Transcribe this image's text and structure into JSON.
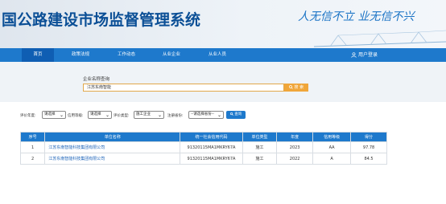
{
  "header": {
    "title": "国公路建设市场监督管理系统",
    "slogan": "人无信不立 业无信不兴"
  },
  "nav": {
    "items": [
      {
        "label": "首页"
      },
      {
        "label": "政策法规"
      },
      {
        "label": "工作动态"
      },
      {
        "label": "从业企业"
      },
      {
        "label": "从业人员"
      }
    ],
    "user_label": "用户登录"
  },
  "search": {
    "label": "企业名称查询",
    "value": "江苏东南智能",
    "button_label": "搜 索"
  },
  "filters": [
    {
      "label": "评价年度:",
      "value": "请选择"
    },
    {
      "label": "信用等级:",
      "value": "请选择"
    },
    {
      "label": "评价类型:",
      "value": "施工企业"
    },
    {
      "label": "注册省份:",
      "value": "--请选择省份--"
    }
  ],
  "query_button": "查询",
  "table": {
    "headers": [
      "序号",
      "单位名称",
      "统一社会信用代码",
      "单位类型",
      "年度",
      "信用等级",
      "得分"
    ],
    "rows": [
      [
        "1",
        "江苏东南智能科技集团有限公司",
        "91320115MA1MKRY67A",
        "施工",
        "2023",
        "AA",
        "97.78"
      ],
      [
        "2",
        "江苏东南智能科技集团有限公司",
        "91320115MA1MKRY67A",
        "施工",
        "2022",
        "A",
        "84.5"
      ]
    ]
  },
  "colors": {
    "nav_bg": "#1e79cc",
    "title": "#0b4f96",
    "search_btn": "#f0a63a",
    "link": "#1a62b8"
  },
  "icons": [
    "user-icon",
    "search-icon",
    "chevron-down-icon"
  ]
}
